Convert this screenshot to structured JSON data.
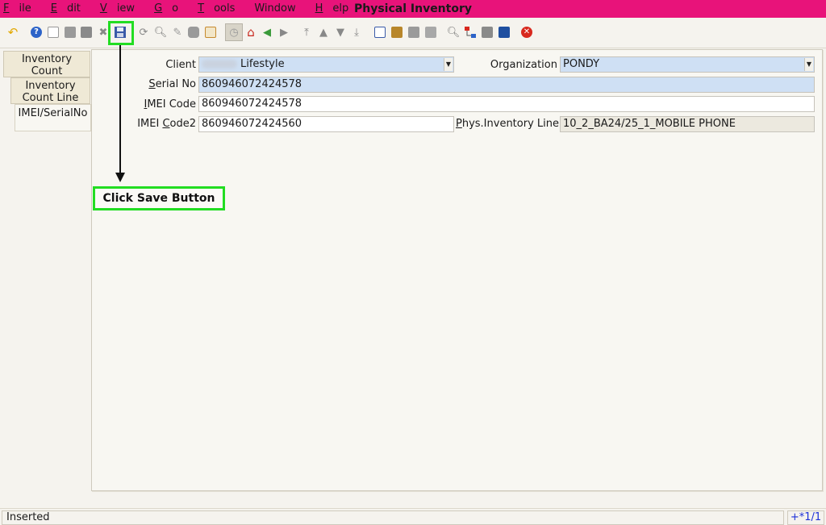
{
  "window": {
    "title": "Physical Inventory"
  },
  "menu": [
    {
      "label": "File",
      "mnemonic": "F",
      "rest": "ile"
    },
    {
      "label": "Edit",
      "mnemonic": "E",
      "rest": "dit"
    },
    {
      "label": "View",
      "mnemonic": "V",
      "rest": "iew"
    },
    {
      "label": "Go",
      "mnemonic": "G",
      "rest": "o"
    },
    {
      "label": "Tools",
      "mnemonic": "T",
      "rest": "ools"
    },
    {
      "label": "Window",
      "mnemonic": "",
      "rest": "Window"
    },
    {
      "label": "Help",
      "mnemonic": "H",
      "rest": "elp"
    }
  ],
  "toolbar": {
    "icons": [
      "undo-icon",
      "help-icon",
      "new-record-icon",
      "copy-record-icon",
      "delete-record-icon",
      "delete-selection-icon",
      "save-icon",
      "refresh-icon",
      "find-icon",
      "attachment-icon",
      "chat-icon",
      "grid-toggle-icon",
      "history-icon",
      "home-icon",
      "back-icon",
      "forward-icon",
      "first-record-icon",
      "previous-record-icon",
      "next-record-icon",
      "last-record-icon",
      "report-icon",
      "archive-icon",
      "print-preview-icon",
      "print-icon",
      "zoom-across-icon",
      "workflow-icon",
      "product-info-icon",
      "active-workflows-icon",
      "exit-icon"
    ]
  },
  "tabs": [
    {
      "line1": "Inventory",
      "line2": "Count"
    },
    {
      "line1": "Inventory",
      "line2": "Count Line"
    },
    {
      "line1": "IMEI/SerialNo",
      "line2": ""
    }
  ],
  "form": {
    "client_label": "Client",
    "client_value": "Lifestyle",
    "organization_label": "Organization",
    "organization_value": "PONDY",
    "serial_label_first": "S",
    "serial_label_rest": "erial No",
    "serial_value": "860946072424578",
    "imei_label_first": "I",
    "imei_label_rest": "MEI Code",
    "imei_value": "860946072424578",
    "imei2_label_pre": "IMEI ",
    "imei2_label_first": "C",
    "imei2_label_rest": "ode2",
    "imei2_value": "860946072424560",
    "physline_label_first": "P",
    "physline_label_rest": "hys.Inventory Line",
    "physline_value": "10_2_BA24/25_1_MOBILE PHONE"
  },
  "annotation": {
    "text": "Click Save Button"
  },
  "status": {
    "message": "Inserted",
    "record": "+*1/1"
  },
  "colors": {
    "titlebar": "#e8137a",
    "highlight": "#22dd22",
    "mandatory_field": "#cfe0f4"
  }
}
